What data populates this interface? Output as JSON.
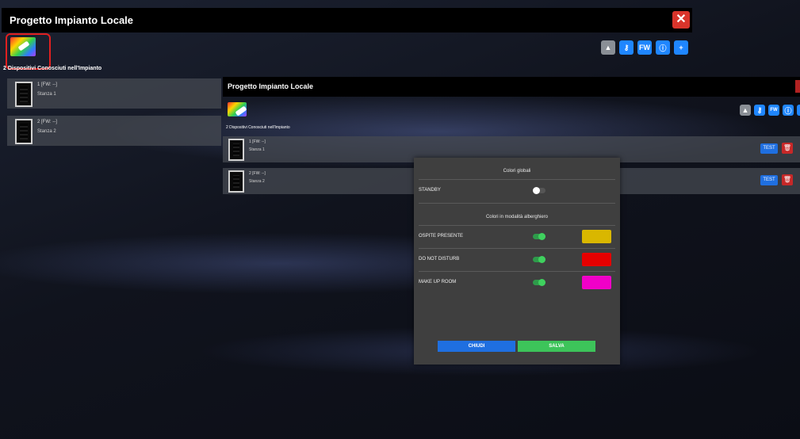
{
  "window_back": {
    "title": "Progetto Impianto Locale",
    "close_icon": "x-icon",
    "count_label": "2 Dispositivi Conosciuti nell'Impianto",
    "toolbar": [
      "alert-icon",
      "key-icon",
      "fw-icon",
      "info-icon",
      "plus-icon"
    ],
    "fw_label": "FW",
    "devices": [
      {
        "name": "1 [FW: --]",
        "room": "Stanza 1"
      },
      {
        "name": "2 [FW: --]",
        "room": "Stanza 2"
      }
    ]
  },
  "window_front": {
    "title": "Progetto Impianto Locale",
    "count_label": "2 Dispositivi Conosciuti nell'Impianto",
    "fw_label": "FW",
    "devices": [
      {
        "name": "1 [FW: --]",
        "room": "Stanza 1",
        "test_label": "TEST"
      },
      {
        "name": "2 [FW: --]",
        "room": "Stanza 2",
        "test_label": "TEST"
      }
    ]
  },
  "modal": {
    "global_header": "Colori globali",
    "standby_label": "STANDBY",
    "standby_on": false,
    "hotel_header": "Colori in modalità alberghiero",
    "items": [
      {
        "label": "OSPITE PRESENTE",
        "on": true,
        "color": "#d9b700"
      },
      {
        "label": "DO NOT DISTURB",
        "on": true,
        "color": "#e60000"
      },
      {
        "label": "MAKE UP ROOM",
        "on": true,
        "color": "#f000c8"
      }
    ],
    "close_label": "CHIUDI",
    "close_color": "#1f6fe0",
    "save_label": "SALVA",
    "save_color": "#3dc45a"
  }
}
